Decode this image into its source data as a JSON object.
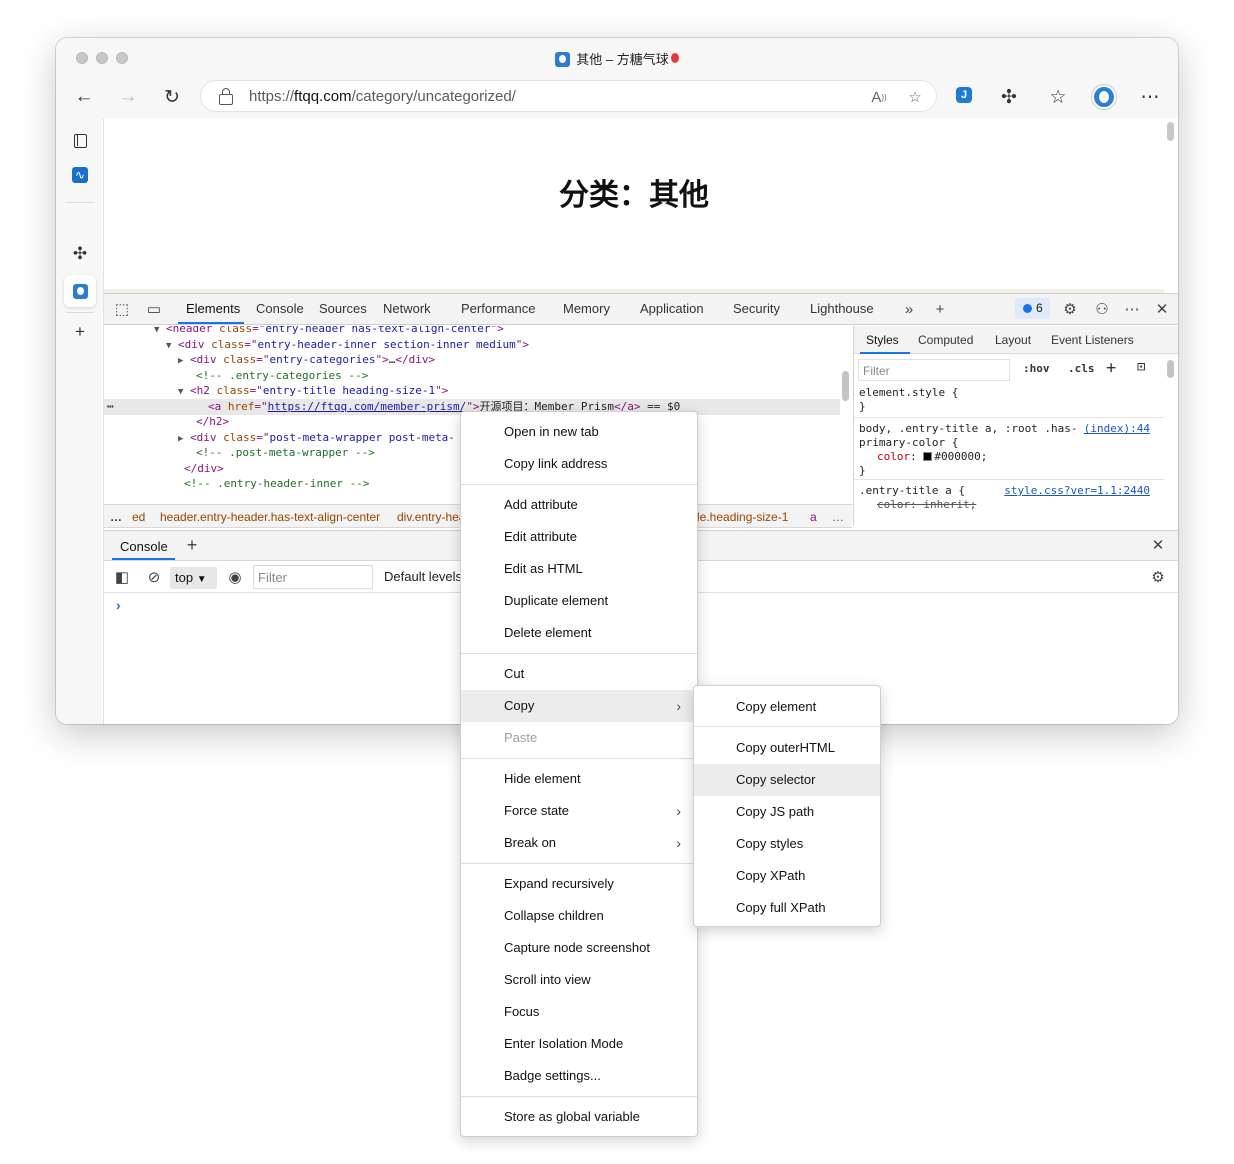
{
  "window": {
    "tab_title": "其他 – 方糖气球"
  },
  "toolbar": {
    "url_scheme": "https://",
    "url_host": "ftqq.com",
    "url_path": "/category/uncategorized/",
    "icons": [
      "back-icon",
      "forward-icon",
      "refresh-icon",
      "lock-icon",
      "read-aloud-icon",
      "add-favorite-icon",
      "extension-j-icon",
      "extensions-icon",
      "favorites-icon",
      "profile-avatar",
      "more-icon"
    ]
  },
  "sidebar": {
    "icons": [
      "tab-actions-icon",
      "performance-icon",
      "extensions-icon",
      "site-favicon",
      "add-icon"
    ]
  },
  "page": {
    "title": "分类：其他"
  },
  "devtools": {
    "tabs": [
      "Elements",
      "Console",
      "Sources",
      "Network",
      "Performance",
      "Memory",
      "Application",
      "Security",
      "Lighthouse"
    ],
    "issues_count": "6",
    "dom_lines": [
      {
        "indent": 62,
        "tri": "▼",
        "parts": [
          [
            "tag",
            "<header "
          ],
          [
            "attr",
            "class"
          ],
          [
            "tag",
            "=\""
          ],
          [
            "val",
            "entry-header has-text-align-center"
          ],
          [
            "tag",
            "\">"
          ]
        ]
      },
      {
        "indent": 74,
        "tri": "▼",
        "parts": [
          [
            "tag",
            "<div "
          ],
          [
            "attr",
            "class"
          ],
          [
            "tag",
            "=\""
          ],
          [
            "val",
            "entry-header-inner section-inner medium"
          ],
          [
            "tag",
            "\">"
          ]
        ]
      },
      {
        "indent": 86,
        "tri": "▶",
        "parts": [
          [
            "tag",
            "<div "
          ],
          [
            "attr",
            "class"
          ],
          [
            "tag",
            "=\""
          ],
          [
            "val",
            "entry-categories"
          ],
          [
            "tag",
            "\">"
          ],
          [
            "txt",
            "…"
          ],
          [
            "tag",
            "</div>"
          ]
        ]
      },
      {
        "indent": 92,
        "tri": "",
        "parts": [
          [
            "cmt",
            "<!-- .entry-categories -->"
          ]
        ]
      },
      {
        "indent": 86,
        "tri": "▼",
        "parts": [
          [
            "tag",
            "<h2 "
          ],
          [
            "attr",
            "class"
          ],
          [
            "tag",
            "=\""
          ],
          [
            "val",
            "entry-title heading-size-1"
          ],
          [
            "tag",
            "\">"
          ]
        ]
      },
      {
        "indent": 104,
        "tri": "",
        "parts": [
          [
            "tag",
            "<a "
          ],
          [
            "attr",
            "href"
          ],
          [
            "tag",
            "=\""
          ],
          [
            "val",
            "https://ftqq.com/member-prism/"
          ],
          [
            "tag",
            "\">"
          ],
          [
            "txt",
            "开源项目：Member Prism"
          ],
          [
            "tag",
            "</a>"
          ],
          [
            "txt",
            " == $0"
          ]
        ]
      },
      {
        "indent": 92,
        "tri": "",
        "parts": [
          [
            "tag",
            "</h2>"
          ]
        ]
      },
      {
        "indent": 86,
        "tri": "▶",
        "parts": [
          [
            "tag",
            "<div "
          ],
          [
            "attr",
            "class"
          ],
          [
            "tag",
            "=\""
          ],
          [
            "val",
            "post-meta-wrapper post-meta-"
          ]
        ]
      },
      {
        "indent": 92,
        "tri": "",
        "parts": [
          [
            "cmt",
            "<!-- .post-meta-wrapper -->"
          ]
        ]
      },
      {
        "indent": 80,
        "tri": "",
        "parts": [
          [
            "tag",
            "</div>"
          ]
        ]
      },
      {
        "indent": 80,
        "tri": "",
        "parts": [
          [
            "cmt",
            "<!-- .entry-header-inner -->"
          ]
        ]
      }
    ],
    "breadcrumbs": [
      "ed",
      "header.entry-header.has-text-align-center",
      "div.entry-hea",
      "itle.heading-size-1",
      "a"
    ],
    "styles": {
      "tabs": [
        "Styles",
        "Computed",
        "Layout",
        "Event Listeners"
      ],
      "filter_placeholder": "Filter",
      "hov": ":hov",
      "cls": ".cls",
      "element_style": "element.style {",
      "rule1_selector": "body, .entry-title a, :root .has-primary-color {",
      "rule1_link": "(index):44",
      "rule1_prop": "color",
      "rule1_value": "#000000;",
      "rule2_selector": ".entry-title a {",
      "rule2_link": "style.css?ver=1.1:2440",
      "rule2_prop": "color: inherit;"
    },
    "drawer": {
      "tab": "Console",
      "context": "top",
      "filter_placeholder": "Filter",
      "levels": "Default levels",
      "prompt": "›"
    }
  },
  "context_menu": {
    "items": [
      "Open in new tab",
      "Copy link address",
      "Add attribute",
      "Edit attribute",
      "Edit as HTML",
      "Duplicate element",
      "Delete element",
      "Cut",
      "Copy",
      "Paste",
      "Hide element",
      "Force state",
      "Break on",
      "Expand recursively",
      "Collapse children",
      "Capture node screenshot",
      "Scroll into view",
      "Focus",
      "Enter Isolation Mode",
      "Badge settings...",
      "Store as global variable"
    ],
    "highlighted": "Copy",
    "disabled": "Paste"
  },
  "copy_submenu": {
    "items": [
      "Copy element",
      "Copy outerHTML",
      "Copy selector",
      "Copy JS path",
      "Copy styles",
      "Copy XPath",
      "Copy full XPath"
    ],
    "highlighted": "Copy selector"
  }
}
